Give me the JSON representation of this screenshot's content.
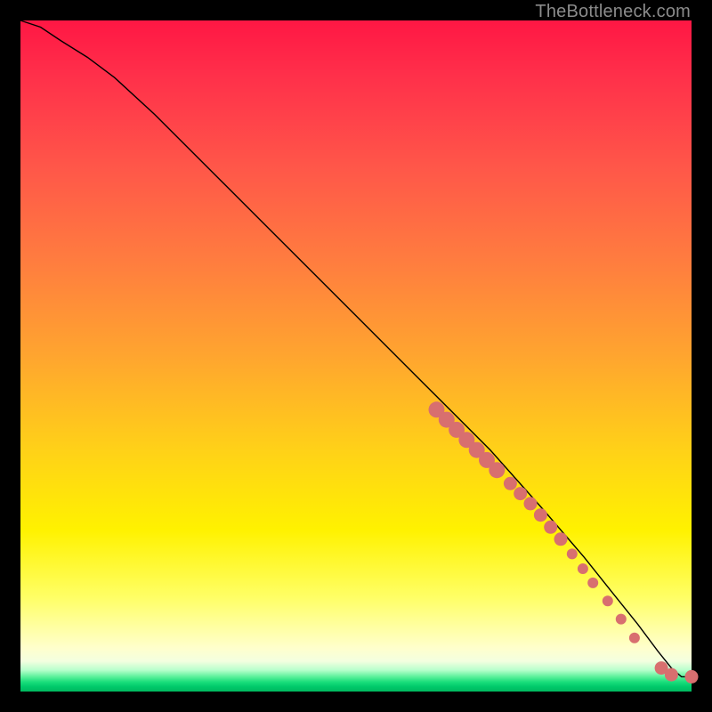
{
  "watermark": "TheBottleneck.com",
  "chart_data": {
    "type": "line",
    "title": "",
    "xlabel": "",
    "ylabel": "",
    "xlim": [
      0,
      100
    ],
    "ylim": [
      0,
      100
    ],
    "grid": false,
    "legend": false,
    "series": [
      {
        "name": "curve",
        "x": [
          0,
          3,
          6,
          10,
          14,
          20,
          30,
          40,
          50,
          60,
          70,
          78,
          84,
          88,
          92,
          95,
          97,
          98.5,
          100
        ],
        "y": [
          100,
          99,
          97,
          94.5,
          91.5,
          86,
          76,
          66,
          56,
          46,
          36,
          27,
          20,
          15,
          10,
          6,
          3.5,
          2.2,
          2.2
        ]
      }
    ],
    "points": [
      {
        "x": 62,
        "y": 42,
        "size": "lg"
      },
      {
        "x": 63.5,
        "y": 40.5,
        "size": "lg"
      },
      {
        "x": 65,
        "y": 39,
        "size": "lg"
      },
      {
        "x": 66.5,
        "y": 37.5,
        "size": "lg"
      },
      {
        "x": 68,
        "y": 36,
        "size": "lg"
      },
      {
        "x": 69.5,
        "y": 34.5,
        "size": "lg"
      },
      {
        "x": 71,
        "y": 33,
        "size": "lg"
      },
      {
        "x": 73,
        "y": 31,
        "size": "md"
      },
      {
        "x": 74.5,
        "y": 29.5,
        "size": "md"
      },
      {
        "x": 76,
        "y": 28,
        "size": "md"
      },
      {
        "x": 77.5,
        "y": 26.3,
        "size": "md"
      },
      {
        "x": 79,
        "y": 24.5,
        "size": "md"
      },
      {
        "x": 80.5,
        "y": 22.7,
        "size": "md"
      },
      {
        "x": 82.2,
        "y": 20.5,
        "size": "sm"
      },
      {
        "x": 83.8,
        "y": 18.3,
        "size": "sm"
      },
      {
        "x": 85.3,
        "y": 16.2,
        "size": "sm"
      },
      {
        "x": 87.5,
        "y": 13.5,
        "size": "sm"
      },
      {
        "x": 89.5,
        "y": 10.8,
        "size": "sm"
      },
      {
        "x": 91.5,
        "y": 8.0,
        "size": "sm"
      },
      {
        "x": 95.5,
        "y": 3.5,
        "size": "md"
      },
      {
        "x": 97,
        "y": 2.5,
        "size": "md"
      },
      {
        "x": 100,
        "y": 2.2,
        "size": "md"
      }
    ],
    "background_gradient": {
      "direction": "vertical",
      "stops": [
        {
          "pos": 0.0,
          "color": "#ff1744"
        },
        {
          "pos": 0.5,
          "color": "#ffa52f"
        },
        {
          "pos": 0.78,
          "color": "#fff200"
        },
        {
          "pos": 0.94,
          "color": "#ffffcc"
        },
        {
          "pos": 0.98,
          "color": "#5af09a"
        },
        {
          "pos": 1.0,
          "color": "#00b85e"
        }
      ]
    }
  }
}
